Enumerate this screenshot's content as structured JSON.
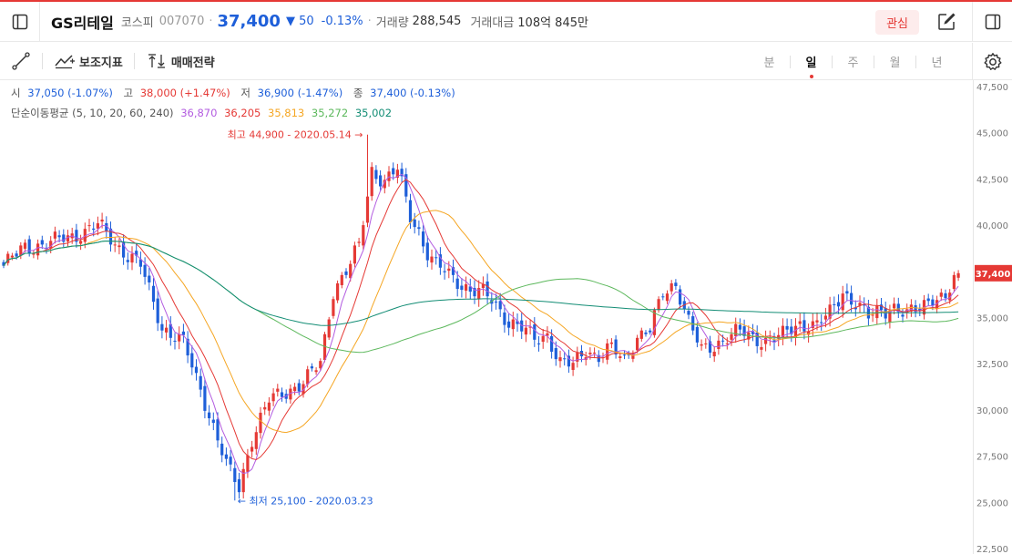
{
  "header": {
    "name": "GS리테일",
    "market": "코스피",
    "code": "007070",
    "price": "37,400",
    "change": "▼ 50",
    "change_pct": "-0.13%",
    "volume_label": "거래량",
    "volume": "288,545",
    "amount_label": "거래대금",
    "amount": "108억 845만",
    "watch_label": "관심",
    "icons": [
      "sidebar-toggle-icon",
      "edit-icon",
      "panel-icon"
    ]
  },
  "toolbar": {
    "indicator_label": "보조지표",
    "strategy_label": "매매전략",
    "periods": [
      "분",
      "일",
      "주",
      "월",
      "년"
    ],
    "active_period": "일"
  },
  "ohlc": {
    "open_label": "시",
    "open": "37,050 (-1.07%)",
    "high_label": "고",
    "high": "38,000 (+1.47%)",
    "low_label": "저",
    "low": "36,900 (-1.47%)",
    "close_label": "종",
    "close": "37,400 (-0.13%)"
  },
  "ma": {
    "label": "단순이동평균 (5, 10, 20, 60, 240)",
    "values": [
      "36,870",
      "36,205",
      "35,813",
      "35,272",
      "35,002"
    ],
    "colors": [
      "#b35ce0",
      "#e53935",
      "#f5a623",
      "#5cb85c",
      "#138d75"
    ]
  },
  "chart_data": {
    "type": "candlestick",
    "y_ticks": [
      "47,500",
      "45,000",
      "42,500",
      "40,000",
      "37,500",
      "35,000",
      "32,500",
      "30,000",
      "27,500",
      "25,000",
      "22,500"
    ],
    "ylim": [
      22500,
      47500
    ],
    "high_annotation": "최고 44,900 - 2020.05.14 →",
    "low_annotation": "← 최저 25,100 - 2020.03.23",
    "current_price_label": "37,400",
    "up_color": "#e53935",
    "down_color": "#1e5fd9",
    "close_keypoints": [
      [
        0,
        37800
      ],
      [
        5,
        38800
      ],
      [
        10,
        39000
      ],
      [
        16,
        39400
      ],
      [
        22,
        40000
      ],
      [
        27,
        38800
      ],
      [
        32,
        37800
      ],
      [
        37,
        34500
      ],
      [
        42,
        33600
      ],
      [
        47,
        30500
      ],
      [
        52,
        27000
      ],
      [
        55,
        25800
      ],
      [
        58,
        28500
      ],
      [
        62,
        30500
      ],
      [
        66,
        31000
      ],
      [
        70,
        31500
      ],
      [
        74,
        32500
      ],
      [
        77,
        36500
      ],
      [
        80,
        37500
      ],
      [
        83,
        38800
      ],
      [
        86,
        43000
      ],
      [
        89,
        42400
      ],
      [
        92,
        43000
      ],
      [
        95,
        40500
      ],
      [
        97,
        39700
      ],
      [
        99,
        38500
      ],
      [
        101,
        37800
      ],
      [
        103,
        37500
      ],
      [
        106,
        37000
      ],
      [
        109,
        36500
      ],
      [
        112,
        36300
      ],
      [
        115,
        35700
      ],
      [
        118,
        34800
      ],
      [
        121,
        34400
      ],
      [
        124,
        33800
      ],
      [
        127,
        34100
      ],
      [
        130,
        32500
      ],
      [
        133,
        32400
      ],
      [
        136,
        33300
      ],
      [
        139,
        32900
      ],
      [
        142,
        33300
      ],
      [
        145,
        32700
      ],
      [
        148,
        34000
      ],
      [
        151,
        34300
      ],
      [
        154,
        36300
      ],
      [
        157,
        36900
      ],
      [
        160,
        34800
      ],
      [
        163,
        33200
      ],
      [
        166,
        33500
      ],
      [
        169,
        34000
      ],
      [
        172,
        34200
      ],
      [
        175,
        33900
      ],
      [
        178,
        33800
      ],
      [
        182,
        34000
      ],
      [
        186,
        34700
      ],
      [
        190,
        34600
      ],
      [
        193,
        35200
      ],
      [
        196,
        36400
      ],
      [
        199,
        35800
      ],
      [
        202,
        35000
      ],
      [
        205,
        35400
      ],
      [
        208,
        35600
      ],
      [
        211,
        35100
      ],
      [
        214,
        35500
      ],
      [
        217,
        36200
      ],
      [
        220,
        36000
      ],
      [
        223,
        37400
      ]
    ]
  }
}
